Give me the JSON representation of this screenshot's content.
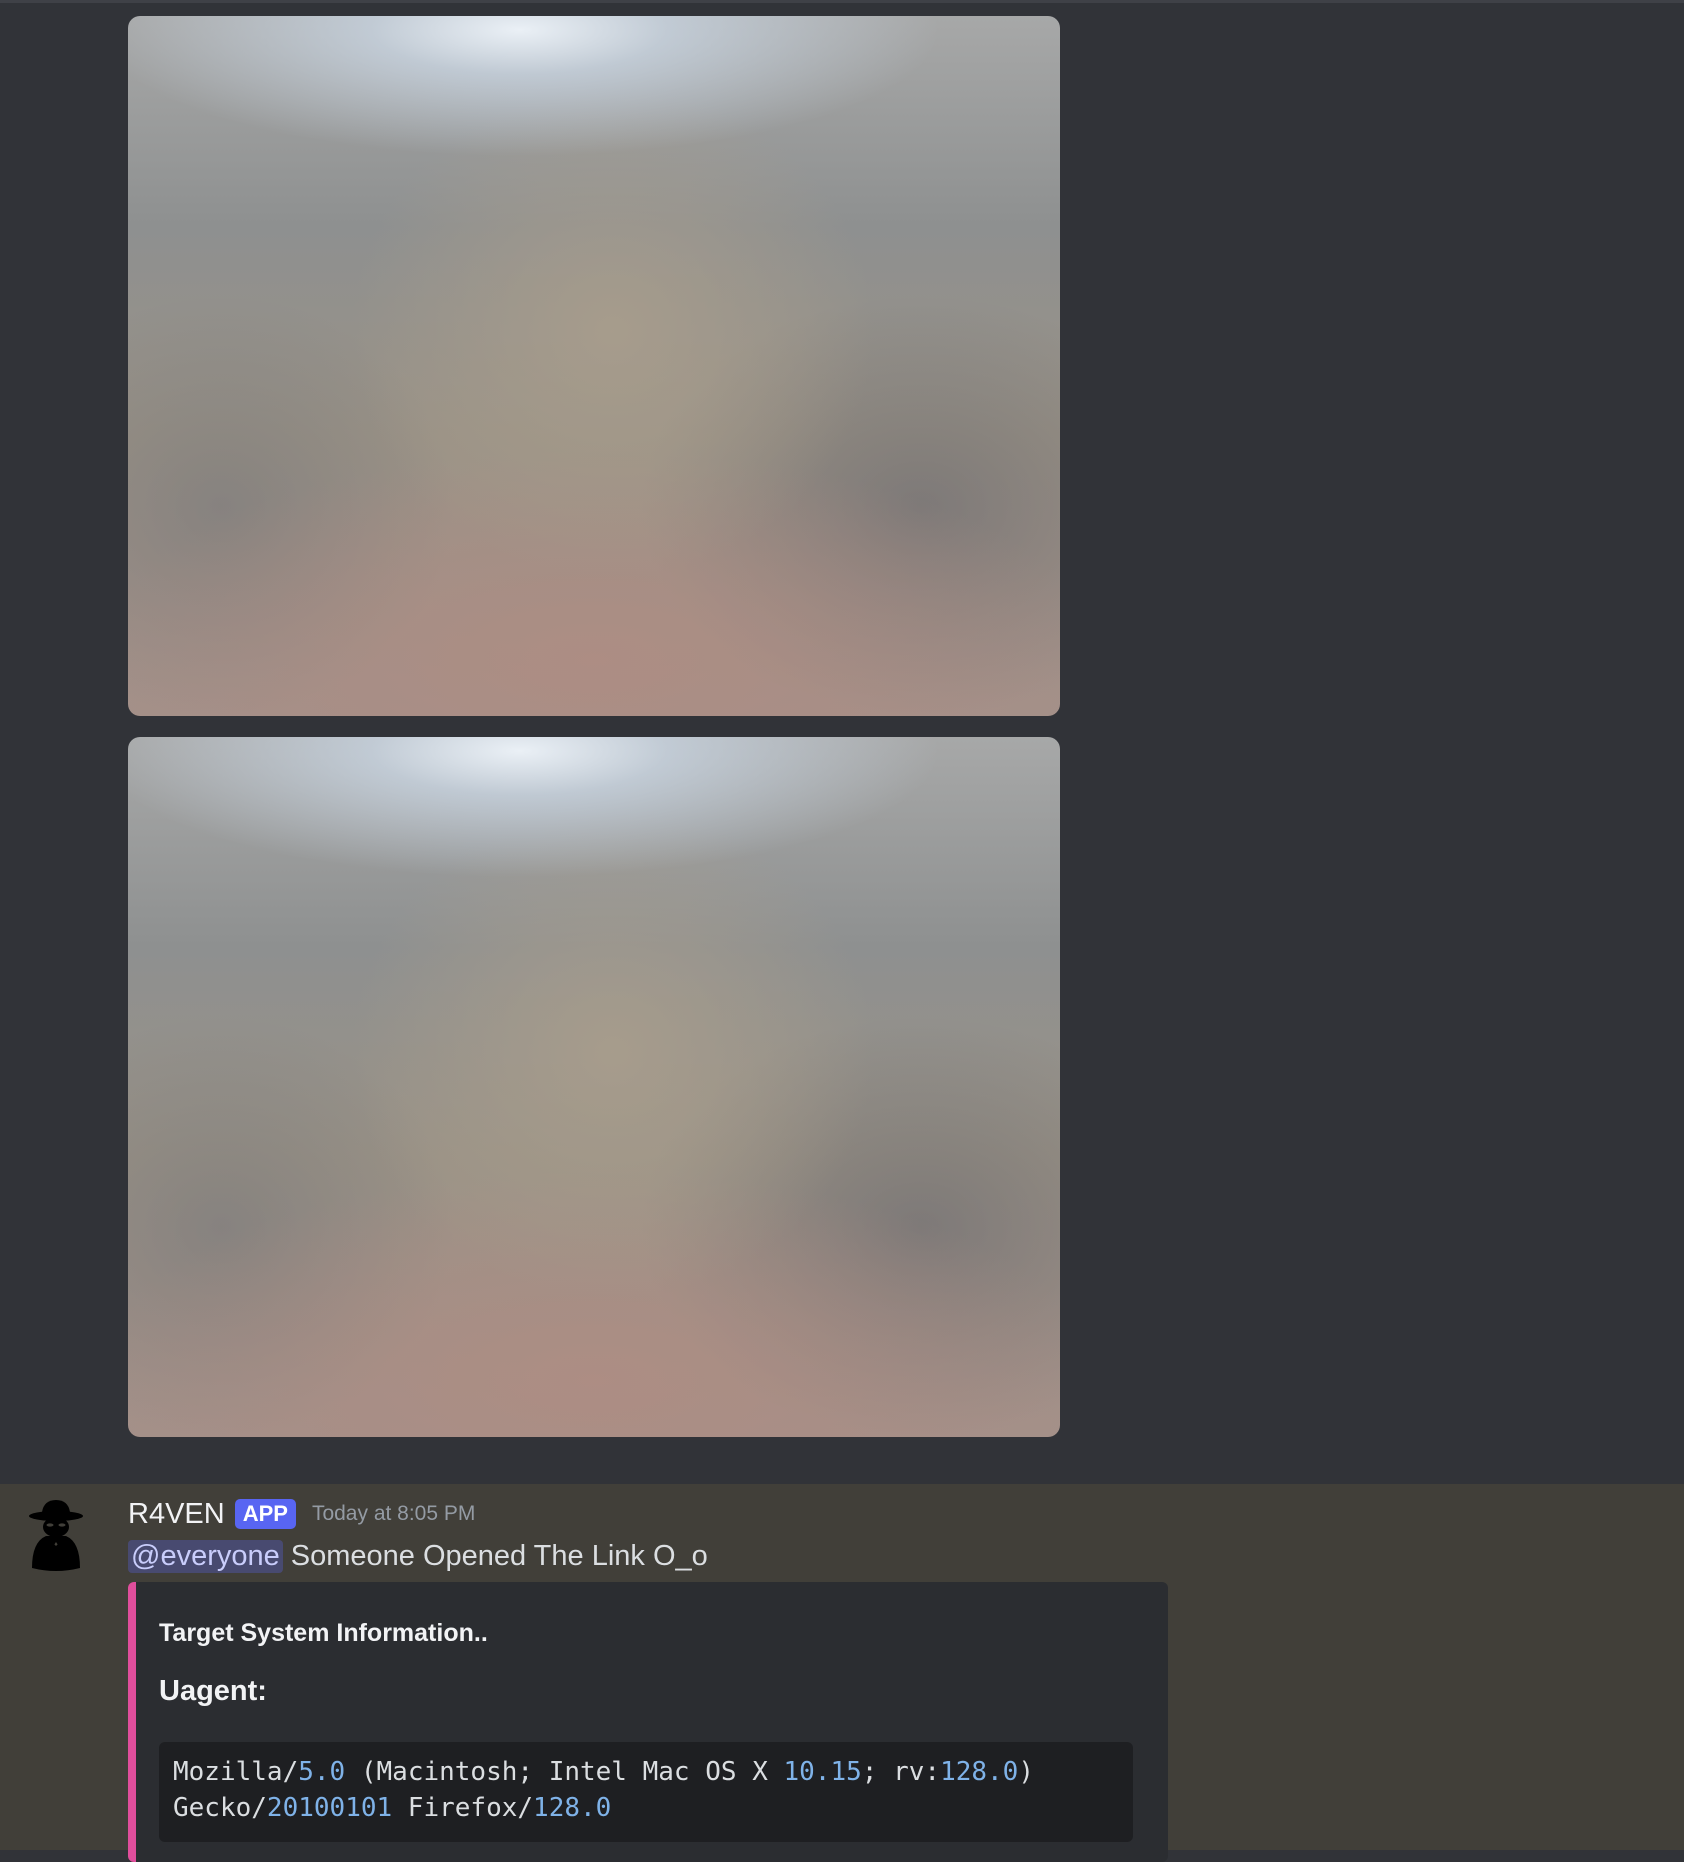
{
  "attachments": [
    {
      "label": "image attachment 1"
    },
    {
      "label": "image attachment 2"
    }
  ],
  "message": {
    "username": "R4VEN",
    "app_tag": "APP",
    "timestamp": "Today at 8:05 PM",
    "mention": "@everyone",
    "text": "Someone Opened The Link O_o",
    "embed": {
      "accent_color": "#e04e9c",
      "title": "Target System Information..",
      "field_name": "Uagent:",
      "code": {
        "line1": [
          {
            "t": "Mozilla/",
            "num": false
          },
          {
            "t": "5.0",
            "num": true
          },
          {
            "t": " (Macintosh; Intel Mac OS X ",
            "num": false
          },
          {
            "t": "10.15",
            "num": true
          },
          {
            "t": "; rv:",
            "num": false
          },
          {
            "t": "128.0",
            "num": true
          },
          {
            "t": ")",
            "num": false
          }
        ],
        "line2": [
          {
            "t": "Gecko/",
            "num": false
          },
          {
            "t": "20100101",
            "num": true
          },
          {
            "t": " Firefox/",
            "num": false
          },
          {
            "t": "128.0",
            "num": true
          }
        ]
      }
    }
  },
  "colors": {
    "background": "#313338",
    "highlighted_message": "#413f39",
    "embed_background": "#2b2d31",
    "app_tag": "#5865f2",
    "number_highlight": "#7fb2e8"
  }
}
